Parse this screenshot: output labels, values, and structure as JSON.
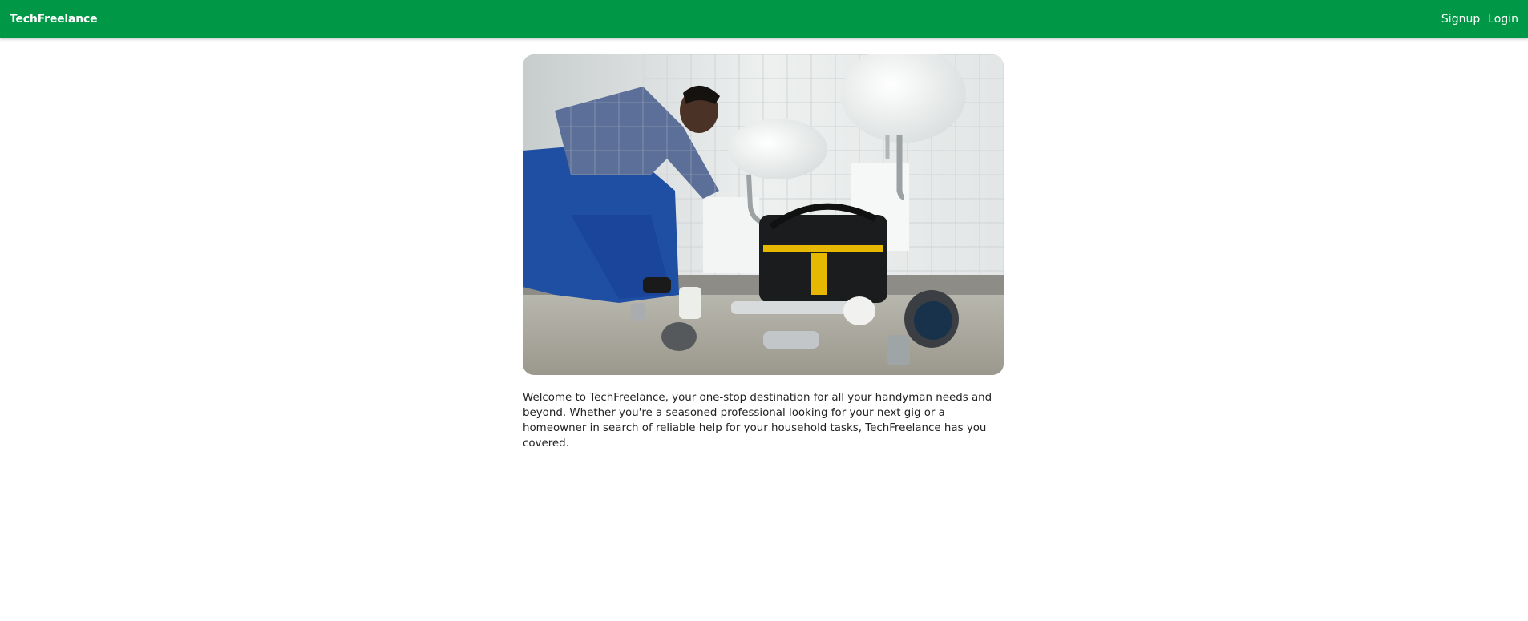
{
  "navbar": {
    "brand": "TechFreelance",
    "links": [
      {
        "label": "Signup"
      },
      {
        "label": "Login"
      }
    ],
    "background_color": "#009846"
  },
  "hero": {
    "image_alt": "Plumber fixing a sink"
  },
  "intro": {
    "text": "Welcome to TechFreelance, your one-stop destination for all your handyman needs and beyond. Whether you're a seasoned professional looking for your next gig or a homeowner in search of reliable help for your household tasks, TechFreelance has you covered."
  }
}
